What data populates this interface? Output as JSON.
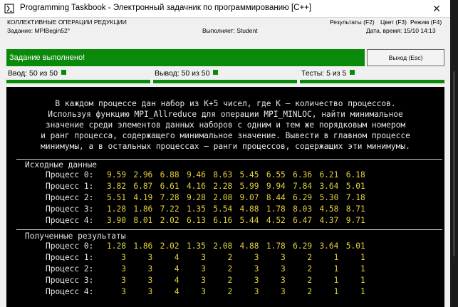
{
  "window": {
    "title": "Programming Taskbook - Электронный задачник по программированию [C++]",
    "close_glyph": "✕"
  },
  "info": {
    "group": "КОЛЛЕКТИВНЫЕ ОПЕРАЦИИ РЕДУКЦИИ",
    "task": "Задание: MPIBegin52°",
    "performer": "Выполняет: Student",
    "results_menu": "Результаты (F2)",
    "color_menu": "Цвет (F3)",
    "mode_menu": "Режим (F4)",
    "datetime": "Дата, время: 15/10 14:13"
  },
  "status": {
    "message": "Задание выполнено!",
    "exit_label": "Выход (Esc)",
    "color": "#0a8a0a"
  },
  "counters": [
    {
      "label": "Ввод: 50 из 50",
      "progress": 1.0
    },
    {
      "label": "Вывод: 50 из 50",
      "progress": 1.0
    },
    {
      "label": "Тесты: 5 из 5",
      "progress": 1.0
    }
  ],
  "console": {
    "task_text": [
      "В каждом процессе дан набор из K+5 чисел, где K — количество процессов.",
      "Используя функцию MPI_Allreduce для операции MPI_MINLOC, найти минимальное",
      "значение среди элементов данных наборов с одним и тем же порядковым номером",
      "и ранг процесса, содержащего минимальное значение. Вывести в главном процессе",
      "минимумы, а в остальных процессах — ранги процессов, содержащих эти минимумы."
    ],
    "input_title": "Исходные данные",
    "input_rows": [
      {
        "label": "Процесс 0:",
        "values": [
          "9.59",
          "2.96",
          "6.88",
          "9.46",
          "8.63",
          "5.45",
          "6.55",
          "6.36",
          "6.21",
          "6.18"
        ]
      },
      {
        "label": "Процесс 1:",
        "values": [
          "3.82",
          "6.87",
          "6.61",
          "4.16",
          "2.28",
          "5.99",
          "9.94",
          "7.84",
          "3.64",
          "5.01"
        ]
      },
      {
        "label": "Процесс 2:",
        "values": [
          "5.51",
          "4.19",
          "7.28",
          "9.28",
          "2.08",
          "9.07",
          "8.44",
          "6.29",
          "5.30",
          "7.18"
        ]
      },
      {
        "label": "Процесс 3:",
        "values": [
          "1.28",
          "1.86",
          "7.22",
          "1.35",
          "5.54",
          "4.88",
          "1.78",
          "8.03",
          "4.58",
          "8.71"
        ]
      },
      {
        "label": "Процесс 4:",
        "values": [
          "3.90",
          "8.01",
          "2.02",
          "6.13",
          "6.16",
          "5.44",
          "4.52",
          "6.47",
          "4.37",
          "9.71"
        ]
      }
    ],
    "output_title": "Полученные результаты",
    "output_rows": [
      {
        "label": "Процесс 0:",
        "values": [
          "1.28",
          "1.86",
          "2.02",
          "1.35",
          "2.08",
          "4.88",
          "1.78",
          "6.29",
          "3.64",
          "5.01"
        ]
      },
      {
        "label": "Процесс 1:",
        "values": [
          "3",
          "3",
          "4",
          "3",
          "2",
          "3",
          "3",
          "2",
          "1",
          "1"
        ]
      },
      {
        "label": "Процесс 2:",
        "values": [
          "3",
          "3",
          "4",
          "3",
          "2",
          "3",
          "3",
          "2",
          "1",
          "1"
        ]
      },
      {
        "label": "Процесс 3:",
        "values": [
          "3",
          "3",
          "4",
          "3",
          "2",
          "3",
          "3",
          "2",
          "1",
          "1"
        ]
      },
      {
        "label": "Процесс 4:",
        "values": [
          "3",
          "3",
          "4",
          "3",
          "2",
          "3",
          "3",
          "2",
          "1",
          "1"
        ]
      }
    ],
    "value_color": "#e6d13a",
    "icon": "taskbook-app-icon"
  }
}
